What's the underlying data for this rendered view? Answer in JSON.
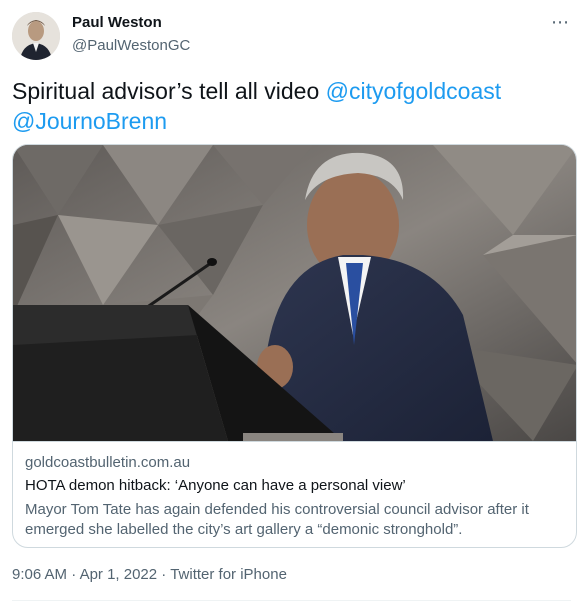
{
  "author": {
    "name": "Paul Weston",
    "handle": "@PaulWestonGC",
    "more_icon": "ellipsis-icon"
  },
  "tweet": {
    "text": "Spiritual advisor’s tell all video ",
    "mentions": [
      "@cityofgoldcoast",
      "@JournoBrenn"
    ]
  },
  "card": {
    "domain": "goldcoastbulletin.com.au",
    "title": "HOTA demon hitback: ‘Anyone can have a personal view’",
    "description": "Mayor Tom Tate has again defended his controversial council advisor after it emerged she labelled the city’s art gallery a “demonic stronghold”."
  },
  "meta": {
    "time": "9:06 AM",
    "separator": " · ",
    "date": "Apr 1, 2022",
    "source": "Twitter for iPhone"
  },
  "colors": {
    "link": "#1d9bf0",
    "secondary_text": "#536471",
    "border": "#cfd9de"
  }
}
